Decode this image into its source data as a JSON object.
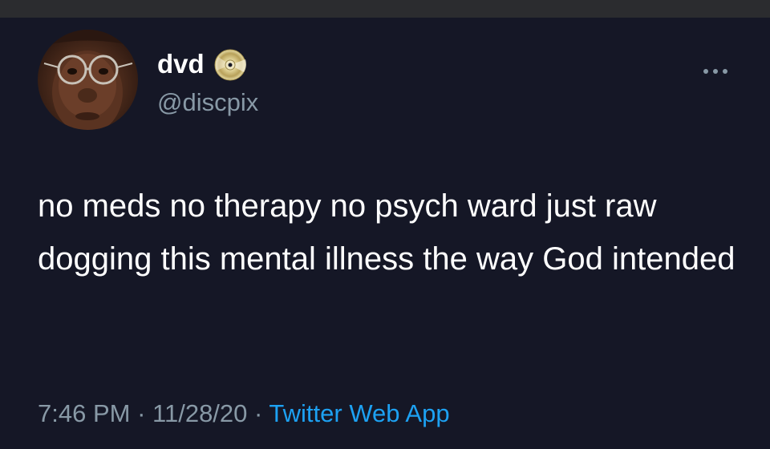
{
  "author": {
    "display_name": "dvd",
    "handle": "@discpix",
    "badge_icon": "dvd-disc-icon",
    "avatar_icon": "profile-photo"
  },
  "tweet": {
    "text": "no meds no therapy no psych ward just raw dogging this mental illness the way God intended",
    "time": "7:46 PM",
    "separator": "·",
    "date": "11/28/20",
    "source": "Twitter Web App"
  },
  "menu": {
    "icon": "more-options-icon"
  },
  "colors": {
    "background": "#151726",
    "text": "#ffffff",
    "muted": "#8899a6",
    "link": "#1da1f2"
  }
}
